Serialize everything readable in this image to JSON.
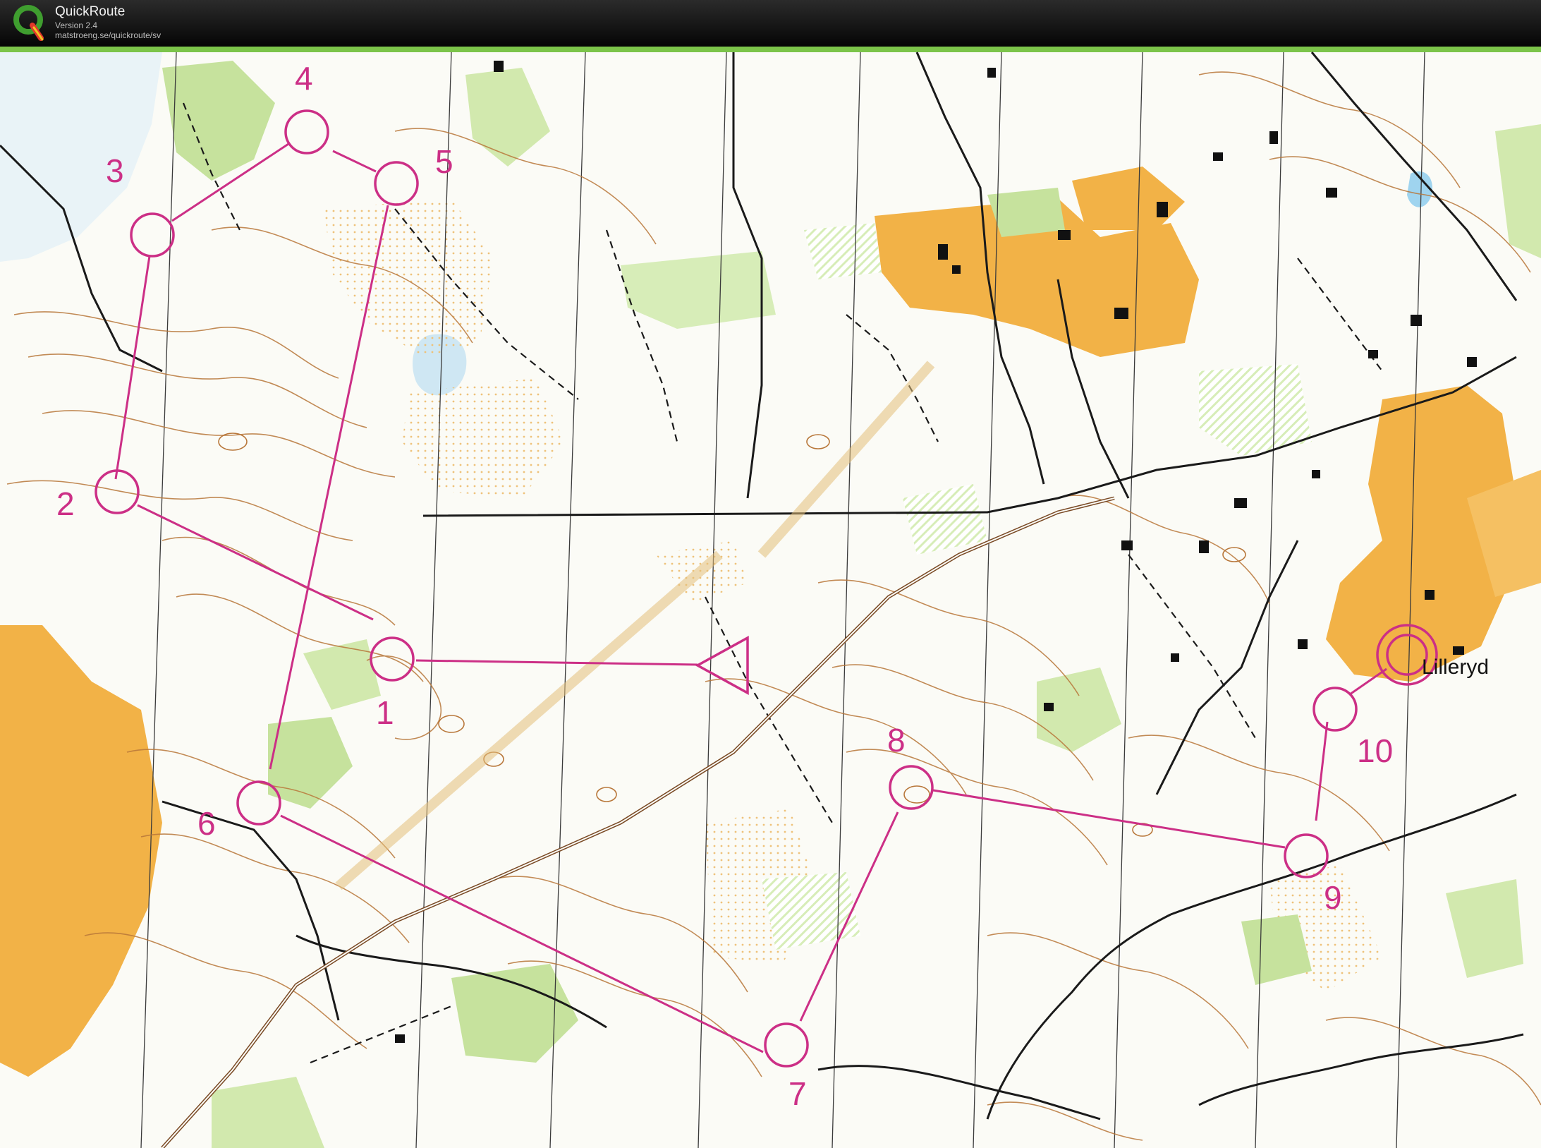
{
  "app": {
    "title": "QuickRoute",
    "version": "Version 2.4",
    "url": "matstroeng.se/quickroute/sv"
  },
  "colors": {
    "course": "#cc2f86",
    "open_land": "#f2b247",
    "forest_green": "#c6e29d",
    "contour": "#b8773a",
    "track": "#1a1a1a",
    "grass_strip": "#7cc44a"
  },
  "map": {
    "place_name": "Lilleryd",
    "controls": [
      {
        "label": "1"
      },
      {
        "label": "2"
      },
      {
        "label": "3"
      },
      {
        "label": "4"
      },
      {
        "label": "5"
      },
      {
        "label": "6"
      },
      {
        "label": "7"
      },
      {
        "label": "8"
      },
      {
        "label": "9"
      },
      {
        "label": "10"
      }
    ]
  }
}
